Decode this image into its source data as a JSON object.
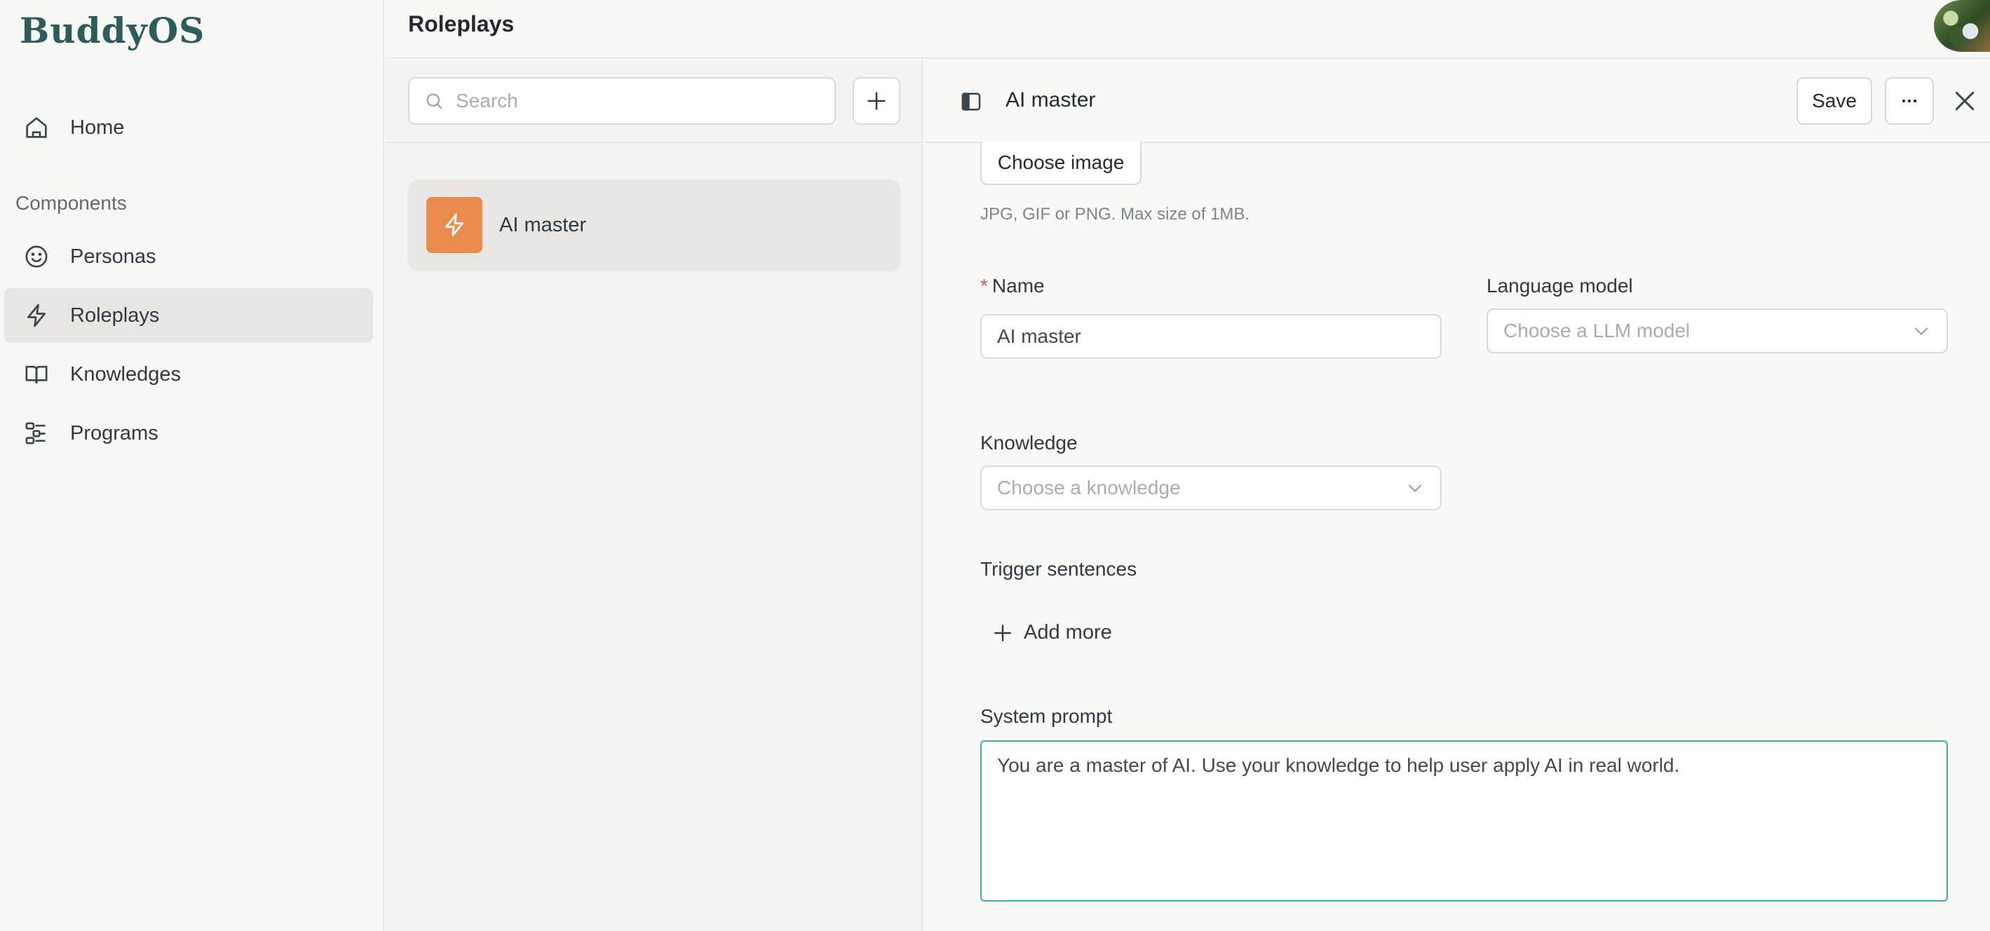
{
  "app": {
    "logo_text": "BuddyOS"
  },
  "sidebar": {
    "home_label": "Home",
    "section_label": "Components",
    "items": [
      {
        "label": "Personas",
        "icon": "smile-icon"
      },
      {
        "label": "Roleplays",
        "icon": "lightning-icon",
        "active": true
      },
      {
        "label": "Knowledges",
        "icon": "book-icon"
      },
      {
        "label": "Programs",
        "icon": "program-icon"
      }
    ]
  },
  "header": {
    "title": "Roleplays"
  },
  "list": {
    "search_placeholder": "Search",
    "items": [
      {
        "label": "AI master",
        "icon": "lightning-icon",
        "color": "#e98b4d"
      }
    ]
  },
  "detail": {
    "title": "AI master",
    "save_label": "Save",
    "choose_image_label": "Choose image",
    "image_hint": "JPG, GIF or PNG. Max size of 1MB.",
    "name_label": "Name",
    "name_required_mark": "*",
    "name_value": "AI master",
    "language_model_label": "Language model",
    "language_model_placeholder": "Choose a LLM model",
    "knowledge_label": "Knowledge",
    "knowledge_placeholder": "Choose a knowledge",
    "trigger_label": "Trigger sentences",
    "add_more_label": "Add more",
    "system_prompt_label": "System prompt",
    "system_prompt_value": "You are a master of AI. Use your knowledge to help user apply AI in real world."
  },
  "colors": {
    "accent": "#48a6ac",
    "brand": "#2e5c5c",
    "roleplay_thumb": "#e98b4d",
    "required": "#d9534f"
  }
}
